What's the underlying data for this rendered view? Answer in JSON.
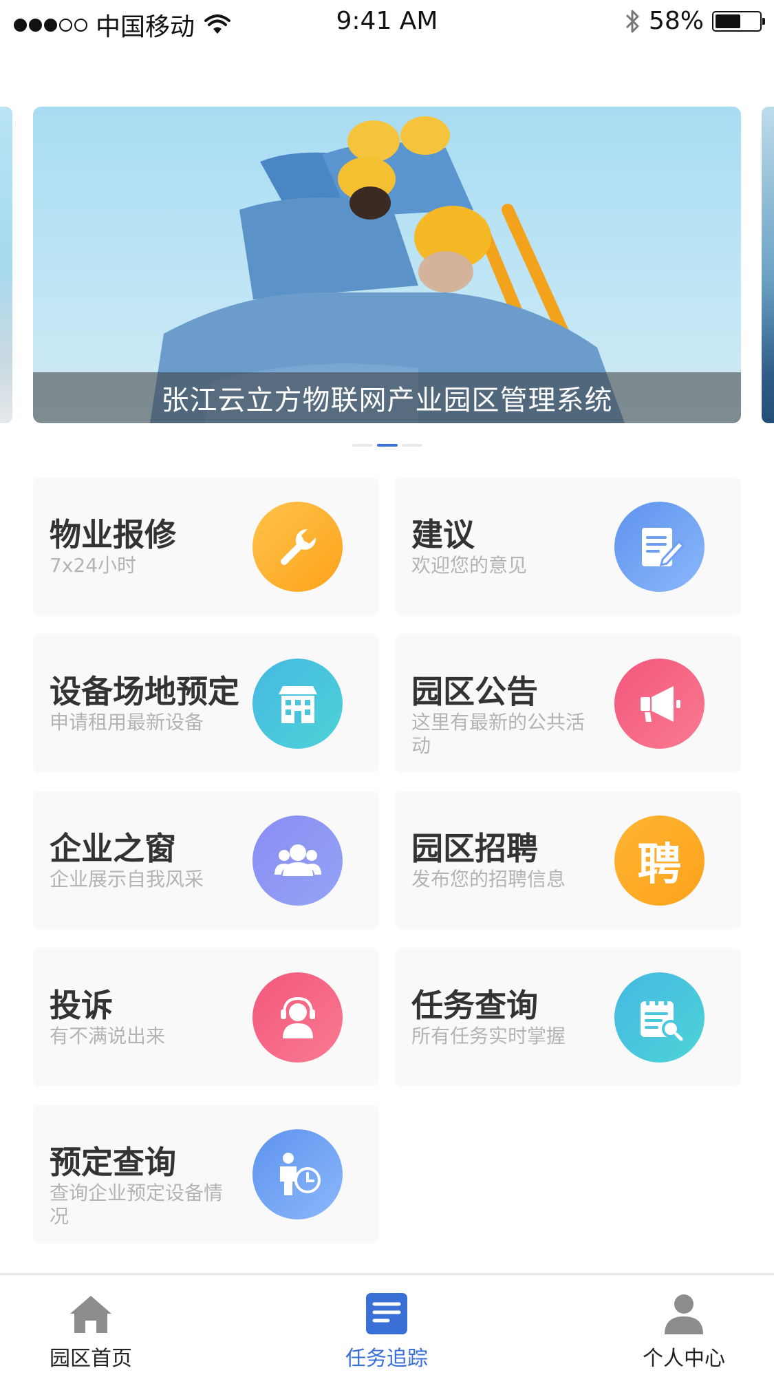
{
  "status_bar": {
    "carrier": "中国移动",
    "time": "9:41 AM",
    "battery": "58%",
    "battery_level": 0.58,
    "signal_bars": 3
  },
  "banner": {
    "caption": "张江云立方物联网产业园区管理系统",
    "page_count": 3,
    "active_index": 1
  },
  "grid": {
    "items": [
      {
        "title": "物业报修",
        "subtitle": "7x24小时",
        "icon": "wrench-icon",
        "color": "#fdb02f"
      },
      {
        "title": "建议",
        "subtitle": "欢迎您的意见",
        "icon": "document-edit-icon",
        "color": "#6d9ef2"
      },
      {
        "title": "设备场地预定",
        "subtitle": "申请租用最新设备",
        "icon": "building-icon",
        "color": "#48c4dd"
      },
      {
        "title": "园区公告",
        "subtitle": "这里有最新的公共活动",
        "icon": "megaphone-icon",
        "color": "#f4637f"
      },
      {
        "title": "企业之窗",
        "subtitle": "企业展示自我风采",
        "icon": "group-icon",
        "color": "#8e96f4"
      },
      {
        "title": "园区招聘",
        "subtitle": "发布您的招聘信息",
        "icon": "recruit-icon",
        "icon_text": "聘",
        "color": "#fdac27"
      },
      {
        "title": "投诉",
        "subtitle": "有不满说出来",
        "icon": "headset-icon",
        "color": "#f5597d"
      },
      {
        "title": "任务查询",
        "subtitle": "所有任务实时掌握",
        "icon": "task-search-icon",
        "color": "#4ac6de"
      },
      {
        "title": "预定查询",
        "subtitle": "查询企业预定设备情况",
        "icon": "reservation-clock-icon",
        "color": "#6b9ff0"
      }
    ]
  },
  "tab_bar": {
    "tabs": [
      {
        "label": "园区首页",
        "icon": "home-icon",
        "active": false
      },
      {
        "label": "任务追踪",
        "icon": "task-list-icon",
        "active": true
      },
      {
        "label": "个人中心",
        "icon": "user-icon",
        "active": false
      }
    ],
    "active_color": "#3a6fd6"
  }
}
